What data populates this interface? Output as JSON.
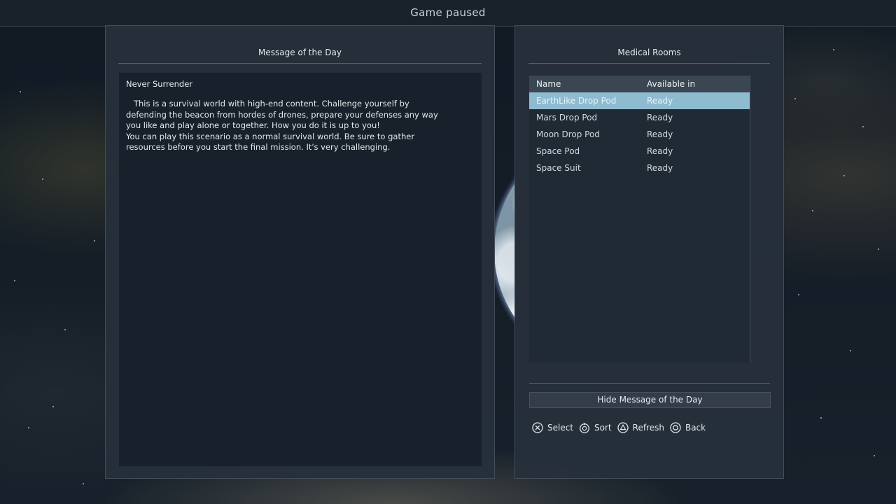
{
  "header": {
    "title": "Game paused"
  },
  "motd_panel": {
    "title": "Message of the Day",
    "heading": "Never Surrender",
    "body": "   This is a survival world with high-end content. Challenge yourself by\ndefending the beacon from hordes of drones, prepare your defenses any way\nyou like and play alone or together. How you do it is up to you!\nYou can play this scenario as a normal survival world. Be sure to gather\nresources before you start the final mission. It's very challenging."
  },
  "rooms_panel": {
    "title": "Medical Rooms",
    "columns": [
      "Name",
      "Available in"
    ],
    "rows": [
      {
        "name": "EarthLike Drop Pod",
        "available": "Ready",
        "selected": true
      },
      {
        "name": "Mars Drop Pod",
        "available": "Ready",
        "selected": false
      },
      {
        "name": "Moon Drop Pod",
        "available": "Ready",
        "selected": false
      },
      {
        "name": "Space Pod",
        "available": "Ready",
        "selected": false
      },
      {
        "name": "Space Suit",
        "available": "Ready",
        "selected": false
      }
    ],
    "hide_button_label": "Hide Message of the Day"
  },
  "hints": [
    {
      "icon": "cross-button-icon",
      "label": "Select"
    },
    {
      "icon": "right-stick-icon",
      "label": "Sort"
    },
    {
      "icon": "triangle-button-icon",
      "label": "Refresh"
    },
    {
      "icon": "circle-button-icon",
      "label": "Back"
    }
  ],
  "colors": {
    "panel_background": "#26303a",
    "selected_row": "#8fbbd0",
    "table_header": "#3a4652",
    "text": "#d6dde2"
  }
}
